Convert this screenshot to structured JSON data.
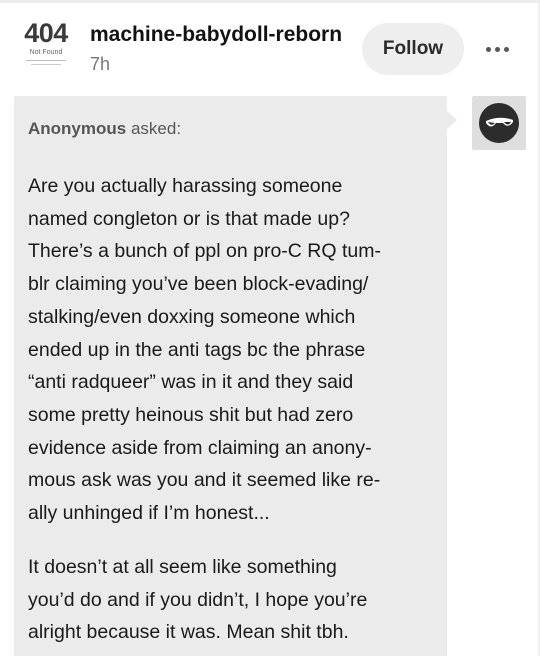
{
  "header": {
    "avatar_code": "404",
    "avatar_caption": "Not Found",
    "blog_name": "machine-babydoll-reborn",
    "time": "7h",
    "follow_label": "Follow"
  },
  "ask": {
    "asker_name": "Anonymous",
    "asker_suffix": "asked:",
    "paragraph1_lines": [
      "Are you actually harassing someone",
      "named congleton or is that made up?",
      "There’s a bunch of ppl on pro-C RQ tum-",
      "blr claiming you’ve been block-evading/",
      "stalking/even doxxing someone which",
      "ended up in the anti tags bc the phrase",
      "“anti radqueer” was in it and they said",
      "some pretty heinous shit but had zero",
      "evidence aside from claiming an anony-",
      "mous ask was you and it seemed like re-",
      "ally unhinged if I’m honest..."
    ],
    "paragraph2_lines": [
      "It doesn’t at all seem like something",
      "you’d do and if you didn’t, I hope you’re",
      "alright because it was. Mean shit tbh."
    ]
  },
  "colors": {
    "bubble": "#ebebeb",
    "follow_bg": "#eeeeee",
    "anon_avatar_bg": "#dedede"
  },
  "icons": {
    "more": "more-dots-icon",
    "anon": "anonymous-sunglasses-icon"
  }
}
